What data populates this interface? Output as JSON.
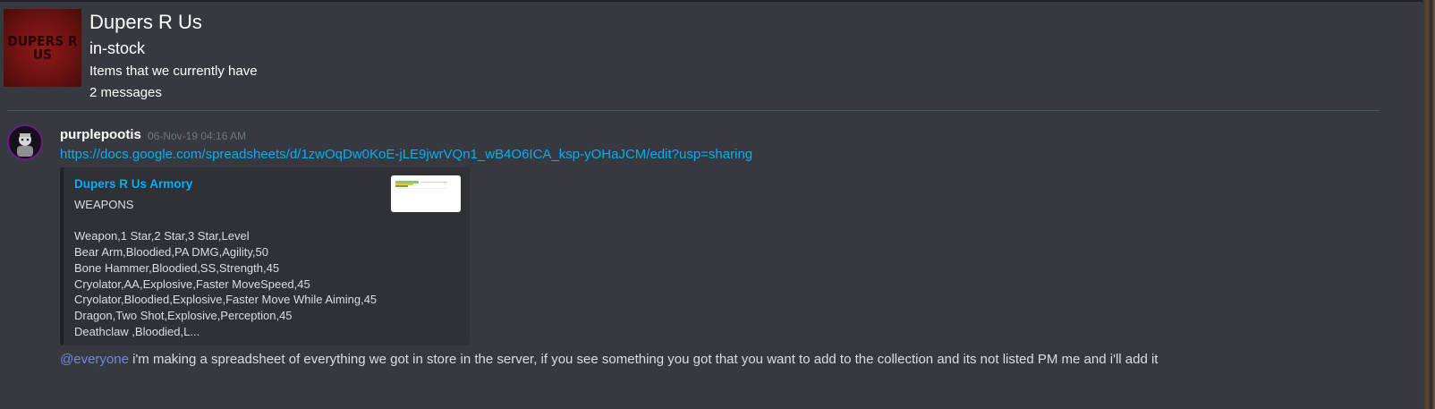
{
  "header": {
    "server_name": "Dupers R Us",
    "server_icon_text": "DUPERS R US",
    "channel_name": "in-stock",
    "channel_topic": "Items that we currently have",
    "message_count": "2 messages"
  },
  "message": {
    "author": "purplepootis",
    "timestamp": "06-Nov-19 04:16 AM",
    "link": "https://docs.google.com/spreadsheets/d/1zwOqDw0KoE-jLE9jwrVQn1_wB4O6ICA_ksp-yOHaJCM/edit?usp=sharing",
    "embed": {
      "title": "Dupers R Us Armory",
      "description": "WEAPONS\n\nWeapon,1 Star,2 Star,3 Star,Level\nBear Arm,Bloodied,PA DMG,Agility,50\nBone Hammer,Bloodied,SS,Strength,45\nCryolator,AA,Explosive,Faster MoveSpeed,45\nCryolator,Bloodied,Explosive,Faster Move While Aiming,45\nDragon,Two Shot,Explosive,Perception,45\nDeathclaw ,Bloodied,L..."
    },
    "mention": "@everyone",
    "text": " i'm making a spreadsheet of everything we got in store in the server, if you see something you got that you want to add to the collection and its not listed PM me and i'll add it"
  },
  "colors": {
    "background": "#36393f",
    "link": "#00b0f4",
    "mention": "#7289da",
    "embed_bg": "#2f3136"
  }
}
